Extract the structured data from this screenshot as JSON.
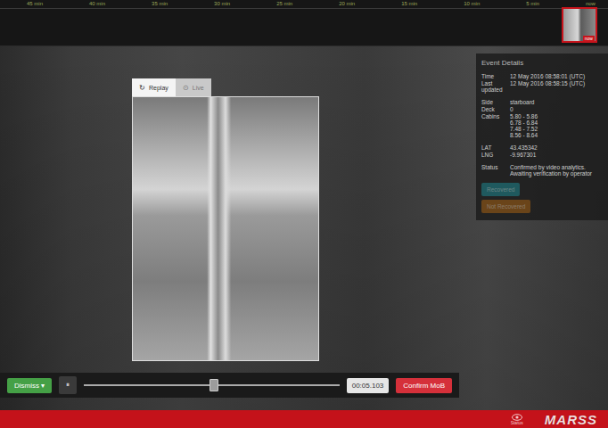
{
  "timeline": {
    "ticks": [
      "45 min",
      "40 min",
      "35 min",
      "30 min",
      "25 min",
      "20 min",
      "15 min",
      "10 min",
      "5 min",
      "now"
    ],
    "thumbnail_label": "now"
  },
  "viewer": {
    "tabs": [
      {
        "label": "Replay",
        "icon": "↻",
        "selected": true
      },
      {
        "label": "Live",
        "icon": "⊙",
        "selected": false
      }
    ]
  },
  "event_details": {
    "title": "Event Details",
    "groups": [
      [
        {
          "label": "Time",
          "value": [
            "12 May 2016 08:58:01 (UTC)"
          ]
        },
        {
          "label": "Last updated",
          "value": [
            "12 May 2016 08:58:15 (UTC)"
          ]
        }
      ],
      [
        {
          "label": "Side",
          "value": [
            "starboard"
          ]
        },
        {
          "label": "Deck",
          "value": [
            "0"
          ]
        },
        {
          "label": "Cabins",
          "value": [
            "5.80 - 5.86",
            "6.78 - 6.84",
            "7.48 - 7.52",
            "8.56 - 8.64"
          ]
        }
      ],
      [
        {
          "label": "LAT",
          "value": [
            "43.435342"
          ]
        },
        {
          "label": "LNG",
          "value": [
            "-9.967301"
          ]
        }
      ],
      [
        {
          "label": "Status",
          "value": [
            "Confirmed by video analytics. Awaiting verification by operator"
          ]
        }
      ]
    ],
    "buttons": [
      {
        "label": "Recovered",
        "color": "#1e7f86"
      },
      {
        "label": "Not Recovered",
        "color": "#9a5c14"
      }
    ]
  },
  "controls": {
    "dismiss": "Dismiss",
    "dismiss_icon": "▾",
    "pause_icon": "⏸",
    "level": 0.51,
    "time": "00:05.103",
    "confirm": "Confirm MoB"
  },
  "status_bar": {
    "status_label": "Status",
    "logo": "MARSS"
  }
}
